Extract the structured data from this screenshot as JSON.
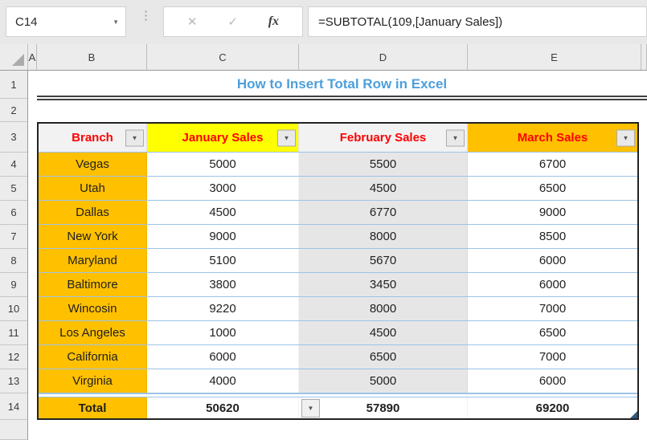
{
  "formula_bar": {
    "cell_reference": "C14",
    "name_box_dropdown_icon": "▼",
    "separator_icon": "⋮",
    "cancel_icon": "✕",
    "enter_icon": "✓",
    "insert_function_label": "fx",
    "formula": "=SUBTOTAL(109,[January Sales])"
  },
  "grid": {
    "column_headers": [
      "A",
      "B",
      "C",
      "D",
      "E"
    ],
    "row_headers": [
      "1",
      "2",
      "3",
      "4",
      "5",
      "6",
      "7",
      "8",
      "9",
      "10",
      "11",
      "12",
      "13",
      "14"
    ]
  },
  "sheet": {
    "title": "How to Insert Total Row in Excel"
  },
  "table": {
    "filter_icon": "▼",
    "total_dropdown_icon": "▼",
    "columns": [
      {
        "label": "Branch",
        "bg": "#F2F2F2"
      },
      {
        "label": "January Sales",
        "bg": "#FFFF00"
      },
      {
        "label": "February Sales",
        "bg": "#F2F2F2"
      },
      {
        "label": "March Sales",
        "bg": "#FFC000"
      }
    ],
    "rows": [
      [
        "Vegas",
        "5000",
        "5500",
        "6700"
      ],
      [
        "Utah",
        "3000",
        "4500",
        "6500"
      ],
      [
        "Dallas",
        "4500",
        "6770",
        "9000"
      ],
      [
        "New York",
        "9000",
        "8000",
        "8500"
      ],
      [
        "Maryland",
        "5100",
        "5670",
        "6000"
      ],
      [
        "Baltimore",
        "3800",
        "3450",
        "6000"
      ],
      [
        "Wincosin",
        "9220",
        "8000",
        "7000"
      ],
      [
        "Los Angeles",
        "1000",
        "4500",
        "6500"
      ],
      [
        "California",
        "6000",
        "6500",
        "7000"
      ],
      [
        "Virginia",
        "4000",
        "5000",
        "6000"
      ]
    ],
    "total_row": [
      "Total",
      "50620",
      "57890",
      "69200"
    ]
  },
  "colors": {
    "accent_orange": "#FFC000",
    "accent_yellow": "#FFFF00",
    "header_text_red": "#FF0000",
    "title_blue": "#4D9FDC",
    "row_line_blue": "#9DC3E6",
    "february_column_gray": "#E7E6E6",
    "table_border_dark": "#222222"
  }
}
